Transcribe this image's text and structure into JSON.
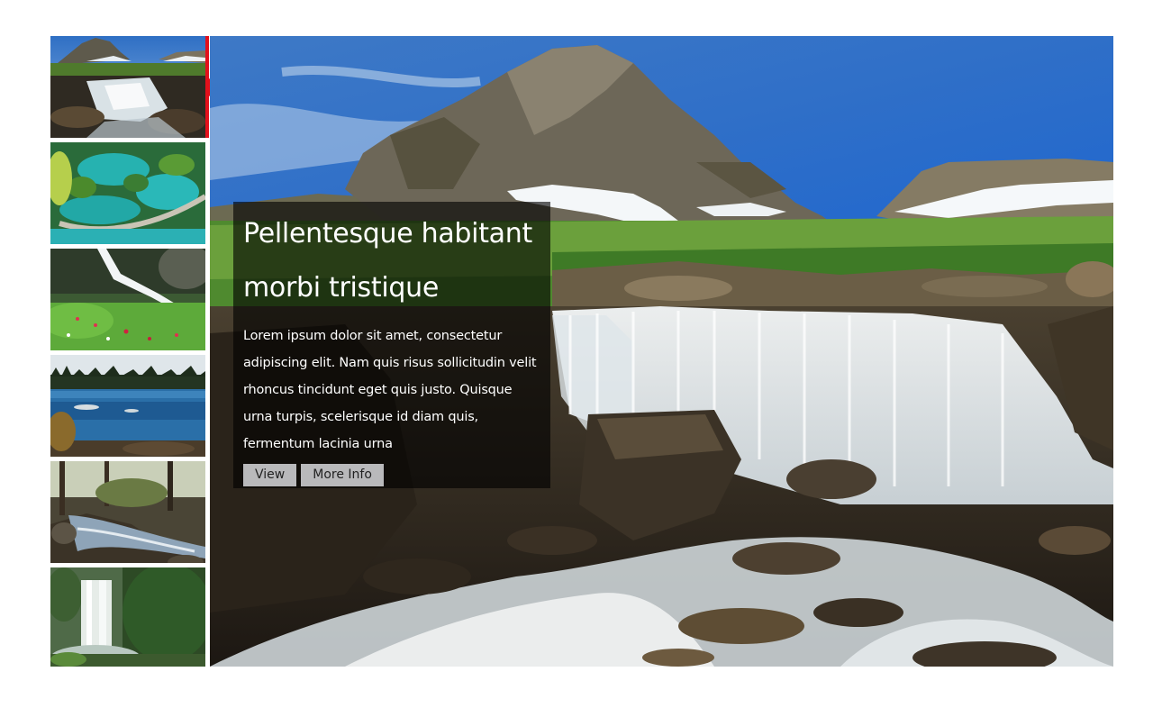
{
  "gallery": {
    "caption": {
      "title": "Pellentesque habitant morbi tristique",
      "text": "Lorem ipsum dolor sit amet, consectetur adipiscing elit. Nam quis risus sollicitudin velit rhoncus tincidunt eget quis justo. Quisque urna turpis, scelerisque id diam quis, fermentum lacinia urna",
      "view_label": "View",
      "more_info_label": "More Info"
    },
    "active_index": 0,
    "thumbnails": [
      {
        "subject": "mountain-waterfall"
      },
      {
        "subject": "turquoise-lakes-boardwalk"
      },
      {
        "subject": "waterfall-meadow-flowers"
      },
      {
        "subject": "lake-treeline"
      },
      {
        "subject": "forest-stream"
      },
      {
        "subject": "jungle-waterfall"
      }
    ],
    "colors": {
      "accent": "#e3101b",
      "button_bg": "#b9b9bb",
      "overlay": "rgba(0,0,0,0.62)"
    }
  }
}
